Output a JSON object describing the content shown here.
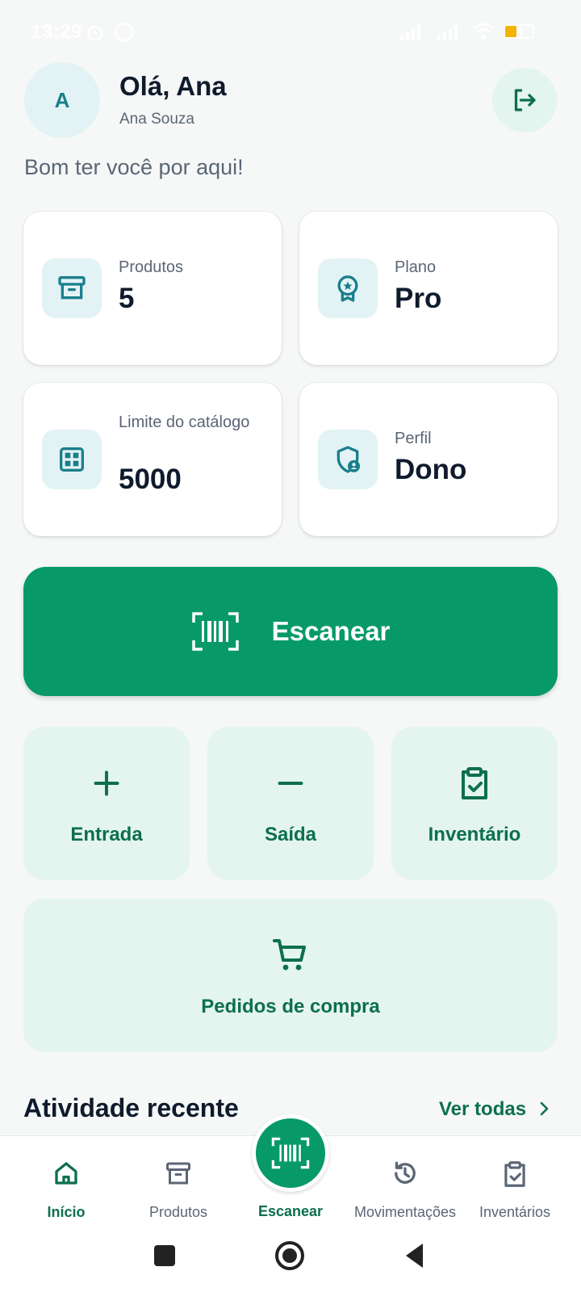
{
  "status_bar": {
    "time": "13:29",
    "battery": "4"
  },
  "header": {
    "avatar_initial": "A",
    "greeting": "Olá, Ana",
    "user_name": "Ana Souza",
    "welcome": "Bom ter você por aqui!"
  },
  "stats": [
    {
      "label": "Produtos",
      "value": "5",
      "icon": "archive-icon"
    },
    {
      "label": "Plano",
      "value": "Pro",
      "icon": "award-icon"
    },
    {
      "label": "Limite do catálogo",
      "value": "5000",
      "icon": "grid-icon"
    },
    {
      "label": "Perfil",
      "value": "Dono",
      "icon": "shield-user-icon"
    }
  ],
  "scan_button": {
    "label": "Escanear",
    "icon": "barcode-icon"
  },
  "actions": [
    {
      "label": "Entrada",
      "icon": "plus-icon"
    },
    {
      "label": "Saída",
      "icon": "minus-icon"
    },
    {
      "label": "Inventário",
      "icon": "clipboard-check-icon"
    },
    {
      "label": "Pedidos de compra",
      "icon": "cart-icon"
    }
  ],
  "recent": {
    "title": "Atividade recente",
    "see_all": "Ver todas"
  },
  "bottom_nav": [
    {
      "label": "Início",
      "icon": "home-icon",
      "active": true
    },
    {
      "label": "Produtos",
      "icon": "archive-icon",
      "active": false
    },
    {
      "label": "Escanear",
      "icon": "barcode-icon",
      "active": false
    },
    {
      "label": "Movimentações",
      "icon": "history-icon",
      "active": false
    },
    {
      "label": "Inventários",
      "icon": "clipboard-check-icon",
      "active": false
    }
  ],
  "colors": {
    "primary": "#079a68",
    "primary_dark": "#0c6f4e",
    "teal_icon": "#1a7f8c",
    "tile_bg": "#e4f4ee",
    "icon_bg": "#e3f3f5"
  }
}
